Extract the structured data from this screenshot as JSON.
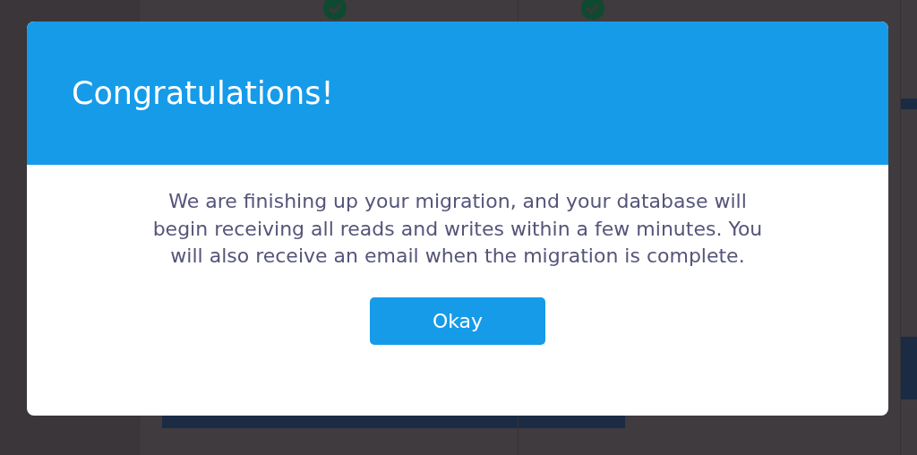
{
  "background": {
    "steps": [
      {
        "done": true
      },
      {
        "done": true
      }
    ]
  },
  "dialog": {
    "title": "Congratulations!",
    "message": "We are finishing up your migration, and your database will begin receiving all reads and writes within a few minutes. You will also receive an email when the migration is complete.",
    "button": "Okay"
  }
}
